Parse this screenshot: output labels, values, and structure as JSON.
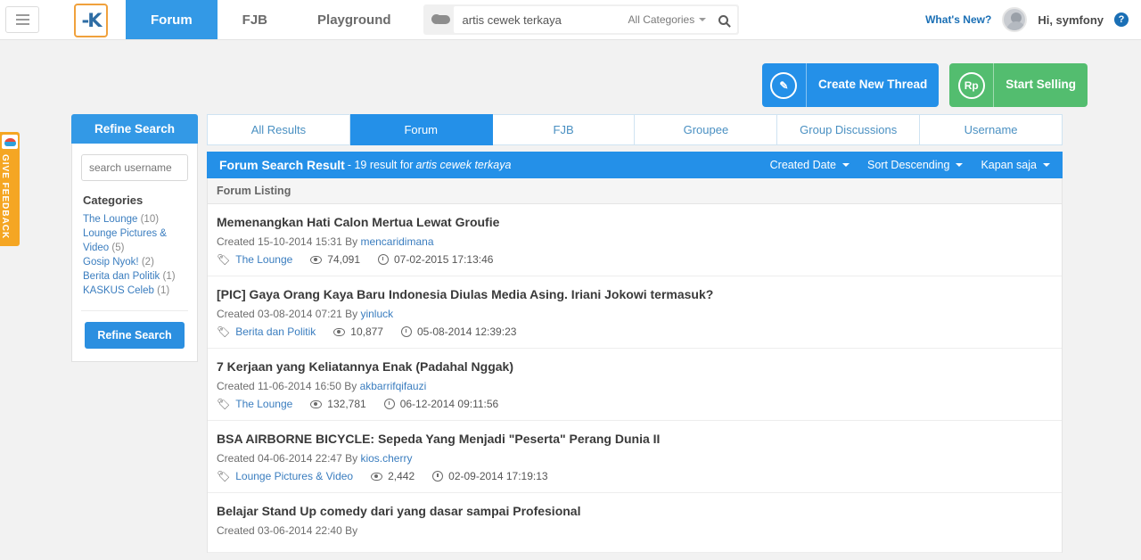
{
  "navbar": {
    "menu_icon": "hamburger-icon",
    "logo_text": "-K",
    "links": [
      {
        "label": "Forum",
        "active": true
      },
      {
        "label": "FJB",
        "active": false
      },
      {
        "label": "Playground",
        "active": false
      }
    ],
    "search": {
      "value": "artis cewek terkaya",
      "placeholder": "Search",
      "category": "All Categories",
      "search_icon": "magnifier-icon",
      "cloud_icon": "cloud-icon"
    },
    "whats_new": "What's New?",
    "greeting": "Hi, symfony",
    "help_label": "?"
  },
  "actions": [
    {
      "label": "Create New Thread",
      "icon": "pencil-icon",
      "color": "#2490e8"
    },
    {
      "label": "Start Selling",
      "icon": "rupiah-icon",
      "color": "#53bd6f"
    }
  ],
  "sidebar": {
    "refine_header": "Refine Search",
    "username_placeholder": "search username",
    "username_value": "",
    "categories_title": "Categories",
    "categories": [
      {
        "name": "The Lounge",
        "count": "(10)"
      },
      {
        "name": "Lounge Pictures & Video",
        "count": "(5)"
      },
      {
        "name": "Gosip Nyok!",
        "count": "(2)"
      },
      {
        "name": "Berita dan Politik",
        "count": "(1)"
      },
      {
        "name": "KASKUS Celeb",
        "count": "(1)"
      }
    ],
    "refine_button": "Refine Search"
  },
  "tabs": [
    {
      "label": "All Results",
      "active": false
    },
    {
      "label": "Forum",
      "active": true
    },
    {
      "label": "FJB",
      "active": false
    },
    {
      "label": "Groupee",
      "active": false
    },
    {
      "label": "Group Discussions",
      "active": false
    },
    {
      "label": "Username",
      "active": false
    }
  ],
  "result_header": {
    "title": "Forum Search Result",
    "summary": "- 19 result for",
    "query": "artis cewek terkaya",
    "tools": [
      {
        "label": "Created Date"
      },
      {
        "label": "Sort Descending"
      },
      {
        "label": "Kapan saja"
      }
    ]
  },
  "listing_label": "Forum Listing",
  "results": [
    {
      "title": "Memenangkan Hati Calon Mertua Lewat Groufie",
      "created_prefix": "Created 15-10-2014 15:31 By ",
      "author": "mencaridimana",
      "category": "The Lounge",
      "views": "74,091",
      "last_post": "07-02-2015 17:13:46"
    },
    {
      "title": "[PIC] Gaya Orang Kaya Baru Indonesia Diulas Media Asing. Iriani Jokowi termasuk?",
      "created_prefix": "Created 03-08-2014 07:21 By ",
      "author": "yinluck",
      "category": "Berita dan Politik",
      "views": "10,877",
      "last_post": "05-08-2014 12:39:23"
    },
    {
      "title": "7 Kerjaan yang Keliatannya Enak (Padahal Nggak)",
      "created_prefix": "Created 11-06-2014 16:50 By ",
      "author": "akbarrifqifauzi",
      "category": "The Lounge",
      "views": "132,781",
      "last_post": "06-12-2014 09:11:56"
    },
    {
      "title": "BSA AIRBORNE BICYCLE: Sepeda Yang Menjadi \"Peserta\" Perang Dunia II",
      "created_prefix": "Created 04-06-2014 22:47 By ",
      "author": "kios.cherry",
      "category": "Lounge Pictures & Video",
      "views": "2,442",
      "last_post": "02-09-2014 17:19:13"
    },
    {
      "title": "Belajar Stand Up comedy dari yang dasar sampai Profesional",
      "created_prefix": "Created 03-06-2014 22:40 By ",
      "author": "",
      "category": "",
      "views": "",
      "last_post": ""
    }
  ],
  "feedback": {
    "label": "GIVE FEEDBACK"
  }
}
